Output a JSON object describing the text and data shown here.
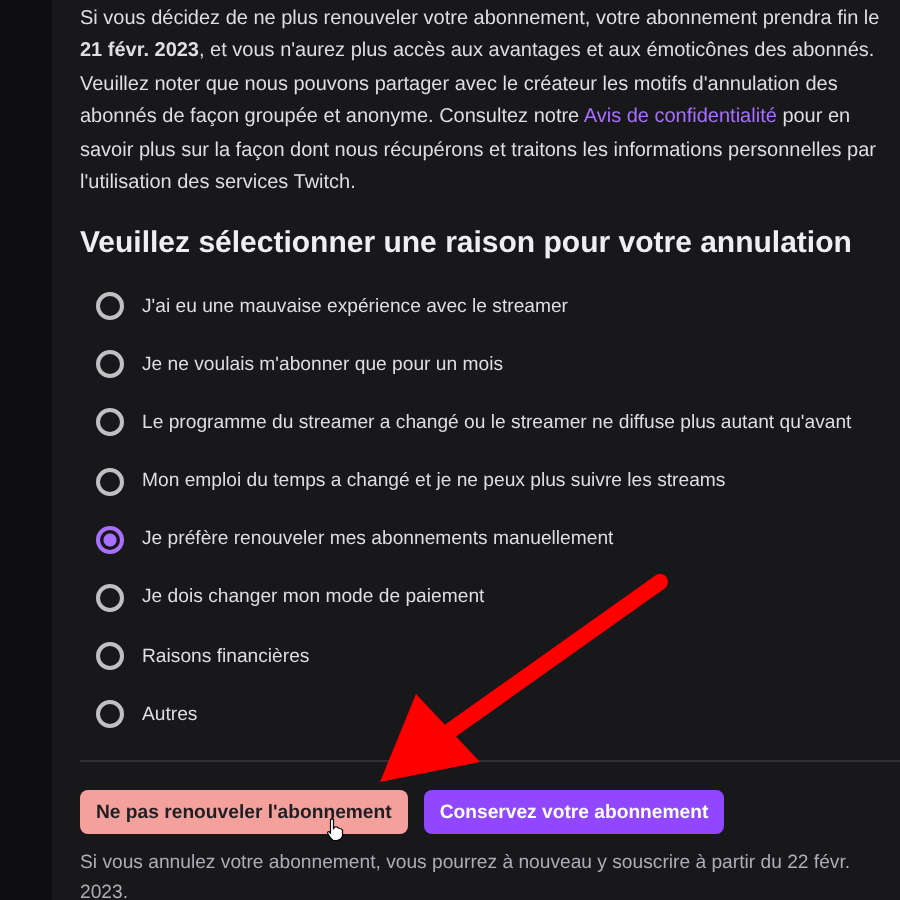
{
  "notice": {
    "before": "Si vous décidez de ne plus renouveler votre abonnement, votre abonnement prendra fin le **21 févr. 2023**, et vous n'aurez plus accès aux avantages et aux émoticônes des abonnés. Veuillez noter que nous pouvons partager avec le créateur les motifs d'annulation des abonnés de façon groupée et anonyme. Consultez notre",
    "link": "Avis de confidentialité",
    "after": "pour en savoir plus sur la façon dont nous récupérons et traitons les informations personnelles par l'utilisation des services Twitch."
  },
  "heading": "Veuillez sélectionner une raison pour votre annulation",
  "reasons": [
    {
      "label": "J'ai eu une mauvaise expérience avec le streamer",
      "selected": false
    },
    {
      "label": "Je ne voulais m'abonner que pour un mois",
      "selected": false
    },
    {
      "label": "Le programme du streamer a changé ou le streamer ne diffuse plus autant qu'avant",
      "selected": false
    },
    {
      "label": "Mon emploi du temps a changé et je ne peux plus suivre les streams",
      "selected": false
    },
    {
      "label": "Je préfère renouveler mes abonnements manuellement",
      "selected": true
    },
    {
      "label": "Je dois changer mon mode de paiement",
      "selected": false
    },
    {
      "label": "Raisons financières",
      "selected": false
    },
    {
      "label": "Autres",
      "selected": false
    }
  ],
  "buttons": [
    {
      "label": "Ne pas renouveler l'abonnement",
      "kind": "cancel"
    },
    {
      "label": "Conservez votre abonnement",
      "kind": "keep"
    }
  ],
  "footer": "Si vous annulez votre abonnement, vous pourrez à nouveau y souscrire à partir du 22 févr. 2023."
}
